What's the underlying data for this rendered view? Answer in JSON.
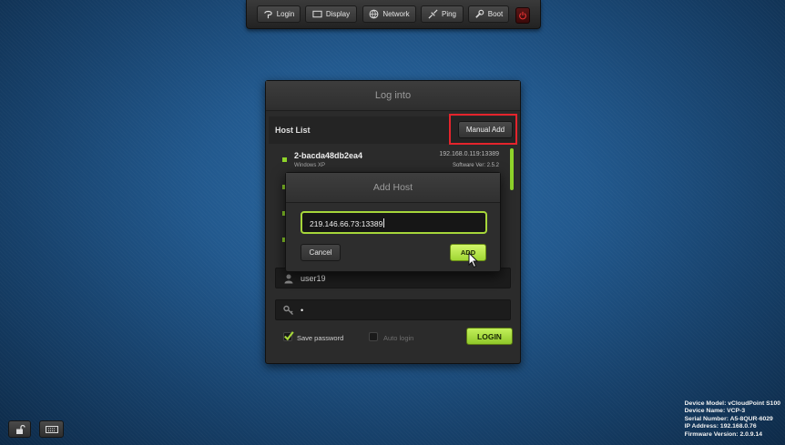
{
  "toolbar": {
    "buttons": [
      {
        "label": "Login",
        "icon": "login-icon"
      },
      {
        "label": "Display",
        "icon": "display-icon"
      },
      {
        "label": "Network",
        "icon": "globe-icon"
      },
      {
        "label": "Ping",
        "icon": "ping-icon"
      },
      {
        "label": "Boot",
        "icon": "wrench-icon"
      }
    ],
    "power_icon": "power-icon"
  },
  "login_panel": {
    "title": "Log into",
    "host_list_label": "Host List",
    "manual_add_label": "Manual Add",
    "hosts": [
      {
        "name": "2-bacda48db2ea4",
        "os": "Windows XP",
        "ip": "192.168.0.119:13389",
        "version": "Software Ver: 2.5.2"
      }
    ],
    "username": "user19",
    "password_mask": "•",
    "save_password_label": "Save password",
    "save_password_checked": true,
    "auto_login_label": "Auto login",
    "auto_login_checked": false,
    "login_label": "LOGIN"
  },
  "add_host_dialog": {
    "title": "Add Host",
    "input_value": "219.146.66.73:13389",
    "cancel_label": "Cancel",
    "add_label": "ADD"
  },
  "device_info": {
    "model": "Device Model: vCloudPoint S100",
    "name": "Device Name: VCP-3",
    "serial": "Serial Number: A5-8QUR-6029",
    "ip": "IP Address: 192.168.0.76",
    "firmware": "Firmware Version: 2.0.9.14"
  },
  "colors": {
    "accent": "#a6d63a",
    "highlight": "#e4242c"
  }
}
